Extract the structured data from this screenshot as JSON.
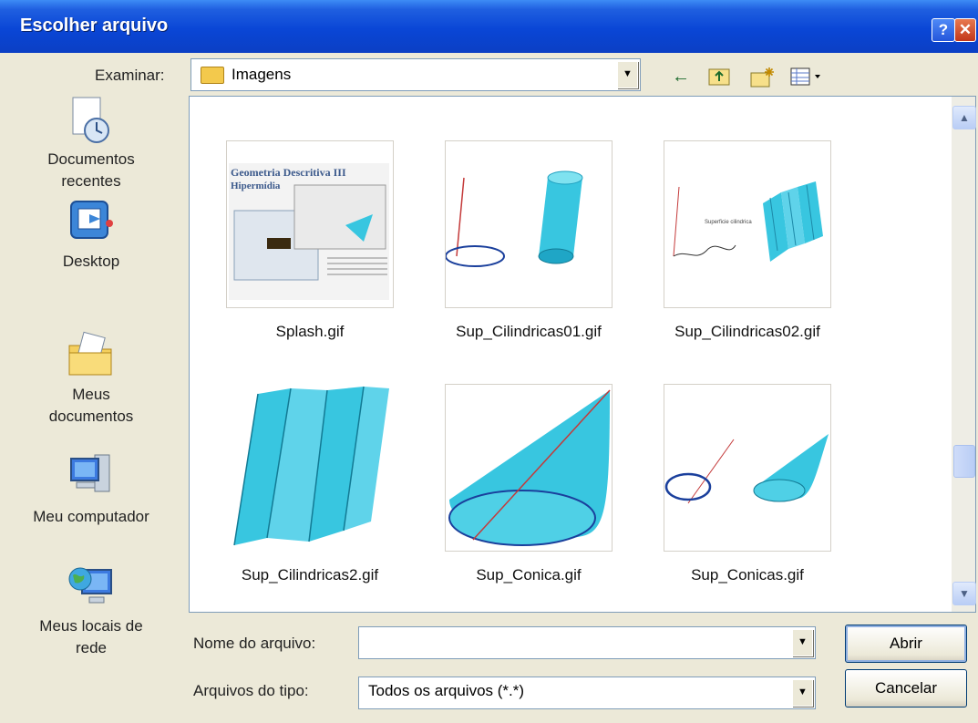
{
  "window": {
    "title": "Escolher arquivo",
    "help_glyph": "?",
    "close_glyph": "✕"
  },
  "look_in": {
    "label": "Examinar:",
    "value": "Imagens"
  },
  "toolbar": {
    "back_icon": "←",
    "up_icon": "⤒",
    "new_folder_icon": "✱",
    "views_icon": "▦▾"
  },
  "places": [
    {
      "line1": "Documentos",
      "line2": "recentes",
      "icon": "recent-documents-icon"
    },
    {
      "line1": "Desktop",
      "line2": "",
      "icon": "desktop-icon"
    },
    {
      "line1": "Meus",
      "line2": "documentos",
      "icon": "my-documents-icon"
    },
    {
      "line1": "Meu computador",
      "line2": "",
      "icon": "my-computer-icon"
    },
    {
      "line1": "Meus locais de",
      "line2": "rede",
      "icon": "network-places-icon"
    }
  ],
  "files": [
    {
      "name": "Splash.gif",
      "thumb_title_1": "Geometria Descritiva III",
      "thumb_title_2": "Hipermídia"
    },
    {
      "name": "Sup_Cilindricas01.gif"
    },
    {
      "name": "Sup_Cilindricas02.gif"
    },
    {
      "name": "Sup_Cilindricas2.gif"
    },
    {
      "name": "Sup_Conica.gif"
    },
    {
      "name": "Sup_Conicas.gif"
    }
  ],
  "filename": {
    "label": "Nome do arquivo:",
    "value": ""
  },
  "filetype": {
    "label": "Arquivos do tipo:",
    "value": "Todos os arquivos (*.*)"
  },
  "buttons": {
    "open": "Abrir",
    "cancel": "Cancelar"
  },
  "colors": {
    "titlebar": "#0a46d6",
    "surface_cyan": "#38c6e0"
  }
}
